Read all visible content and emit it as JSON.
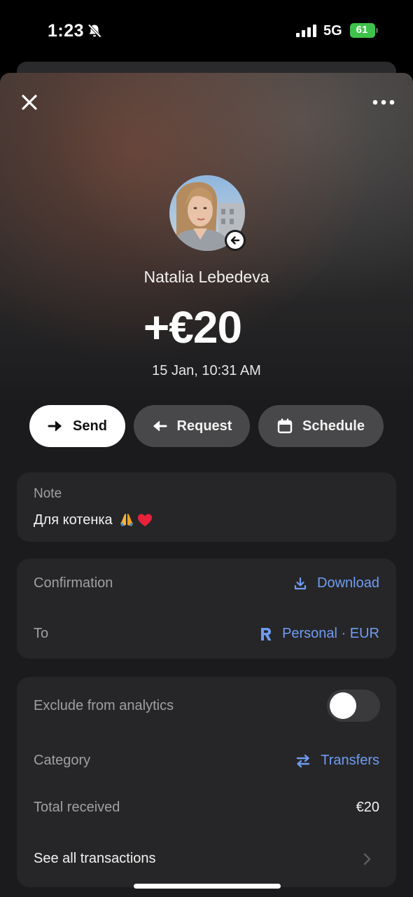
{
  "status_bar": {
    "time": "1:23",
    "network": "5G",
    "battery": "61",
    "icons": [
      "bell-muted-icon",
      "signal-icon",
      "battery-charging-icon"
    ]
  },
  "header": {
    "close_icon": "close-icon",
    "more_icon": "more-horizontal-icon"
  },
  "transaction": {
    "contact_name": "Natalia Lebedeva",
    "amount": "+€20",
    "date": "15 Jan, 10:31 AM",
    "direction_icon": "arrow-left-icon"
  },
  "actions": [
    {
      "label": "Send",
      "icon": "arrow-right-icon"
    },
    {
      "label": "Request",
      "icon": "arrow-left-icon"
    },
    {
      "label": "Schedule",
      "icon": "calendar-icon"
    }
  ],
  "note": {
    "label": "Note",
    "text": "Для котенка",
    "emojis": [
      "folded-hands-emoji",
      "red-heart-emoji"
    ]
  },
  "details": {
    "confirmation_label": "Confirmation",
    "download_label": "Download",
    "to_label": "To",
    "to_value": "Personal · EUR"
  },
  "analytics": {
    "exclude_label": "Exclude from analytics",
    "exclude_enabled": false,
    "category_label": "Category",
    "category_value": "Transfers",
    "total_label": "Total received",
    "total_value": "€20",
    "see_all_label": "See all transactions"
  },
  "colors": {
    "accent_blue": "#6f9cf3",
    "battery_green": "#3ec24b",
    "card_bg": "#262628",
    "pill_dark": "#48484a"
  }
}
